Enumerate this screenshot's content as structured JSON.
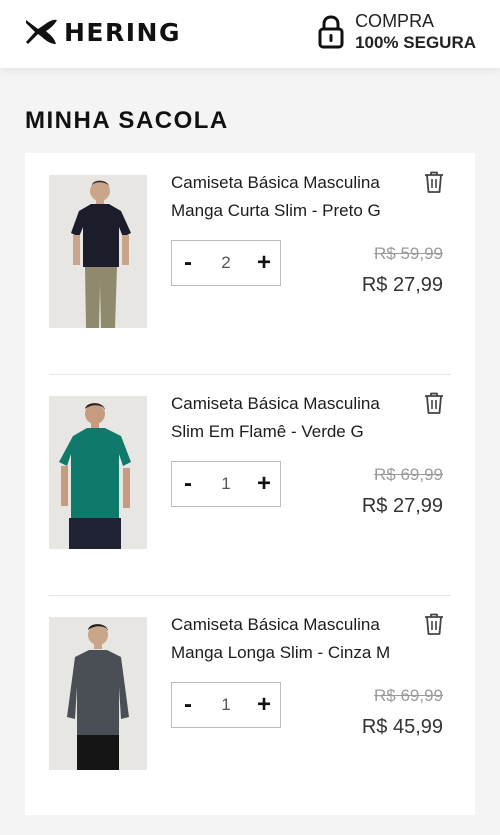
{
  "header": {
    "brand": "HERING",
    "secure_top": "COMPRA",
    "secure_bottom": "100% SEGURA",
    "icons": {
      "logo": "hering-fish-logo",
      "lock": "lock-icon"
    }
  },
  "page": {
    "title": "MINHA SACOLA"
  },
  "bag": {
    "items": [
      {
        "name": "Camiseta Básica Masculina Manga Curta Slim - Preto G",
        "quantity": "2",
        "old_price": "R$ 59,99",
        "price": "R$ 27,99",
        "shirt_color": "#1b1d2a",
        "decrement": "-",
        "increment": "+"
      },
      {
        "name": "Camiseta Básica Masculina Slim Em Flamê - Verde G",
        "quantity": "1",
        "old_price": "R$ 69,99",
        "price": "R$ 27,99",
        "shirt_color": "#0f7a6c",
        "decrement": "-",
        "increment": "+"
      },
      {
        "name": "Camiseta Básica Masculina Manga Longa Slim - Cinza M",
        "quantity": "1",
        "old_price": "R$ 69,99",
        "price": "R$ 45,99",
        "shirt_color": "#4a4f55",
        "decrement": "-",
        "increment": "+"
      }
    ]
  }
}
